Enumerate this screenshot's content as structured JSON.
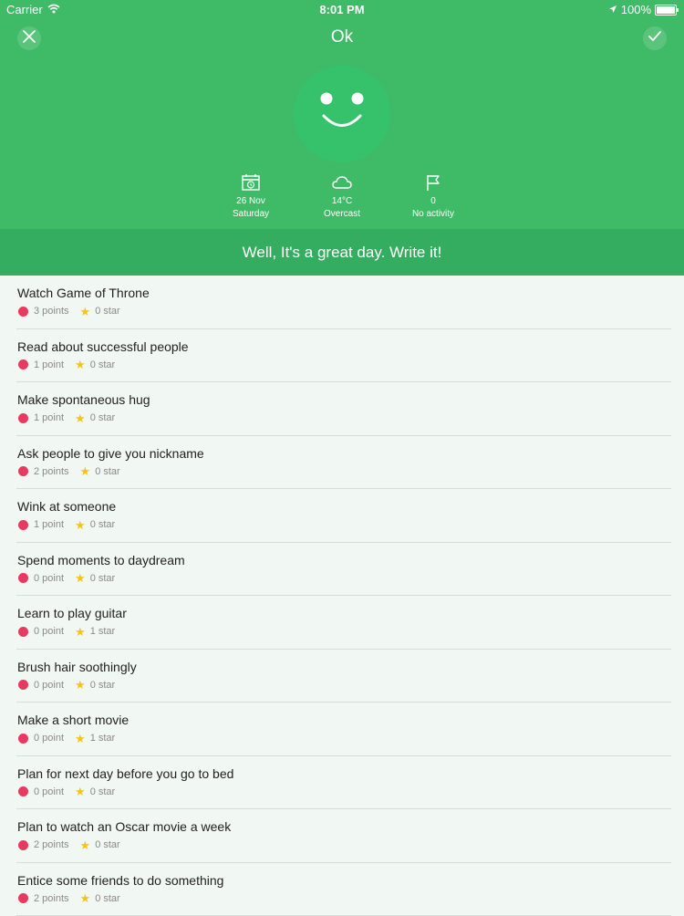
{
  "status_bar": {
    "carrier": "Carrier",
    "time": "8:01 PM",
    "battery": "100%"
  },
  "header": {
    "title": "Ok"
  },
  "stats": {
    "date": {
      "line1": "26 Nov",
      "line2": "Saturday"
    },
    "weather": {
      "line1": "14°C",
      "line2": "Overcast"
    },
    "activity": {
      "line1": "0",
      "line2": "No activity"
    }
  },
  "banner": {
    "text": "Well, It's a great day. Write it!"
  },
  "colors": {
    "header_green": "#3fbb67",
    "banner_green": "#35ad60",
    "points_dot": "#e8395e",
    "star": "#f5c417"
  },
  "icons": {
    "close": "close-icon",
    "check": "check-icon",
    "face": "smiley-face",
    "calendar": "calendar-icon",
    "weather": "cloud-icon",
    "activity": "flag-icon",
    "points": "dot-icon",
    "stars": "star-icon"
  },
  "activities": [
    {
      "title": "Watch Game of Throne",
      "points": "3 points",
      "stars": "0 star"
    },
    {
      "title": "Read about successful people",
      "points": "1 point",
      "stars": "0 star"
    },
    {
      "title": "Make spontaneous hug",
      "points": "1 point",
      "stars": "0 star"
    },
    {
      "title": "Ask people to give you nickname",
      "points": "2 points",
      "stars": "0 star"
    },
    {
      "title": "Wink at someone",
      "points": "1 point",
      "stars": "0 star"
    },
    {
      "title": "Spend moments to daydream",
      "points": "0 point",
      "stars": "0 star"
    },
    {
      "title": "Learn to play guitar",
      "points": "0 point",
      "stars": "1 star"
    },
    {
      "title": "Brush hair soothingly",
      "points": "0 point",
      "stars": "0 star"
    },
    {
      "title": "Make a short movie",
      "points": "0 point",
      "stars": "1 star"
    },
    {
      "title": "Plan for next day before you go to bed",
      "points": "0 point",
      "stars": "0 star"
    },
    {
      "title": "Plan to watch an Oscar movie a week",
      "points": "2 points",
      "stars": "0 star"
    },
    {
      "title": "Entice some friends to do something",
      "points": "2 points",
      "stars": "0 star"
    }
  ]
}
